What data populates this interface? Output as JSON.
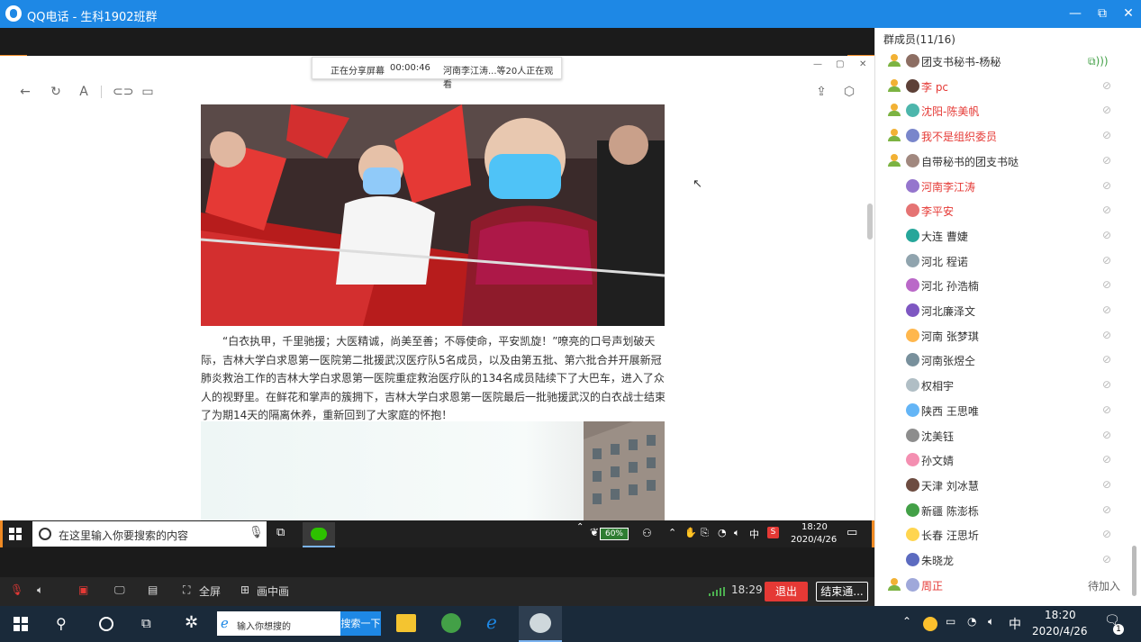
{
  "window": {
    "title": "QQ电话 - 生科1902班群",
    "min": "—",
    "max": "⧉",
    "close": "✕"
  },
  "share_bar": {
    "status": "正在分享屏幕",
    "time": "00:00:46",
    "viewers": "河南李江涛...等20人正在观看"
  },
  "article": {
    "paragraph": "“白衣执甲，千里驰援；大医精诚，尚美至善；不辱使命，平安凯旋！”嘹亮的口号声划破天际，吉林大学白求恩第一医院第二批援武汉医疗队5名成员，以及由第五批、第六批合并开展新冠肺炎救治工作的吉林大学白求恩第一医院重症救治医疗队的134名成员陆续下了大巴车，进入了众人的视野里。在鲜花和掌声的簇拥下，吉林大学白求恩第一医院最后一批驰援武汉的白衣战士结束了为期14天的隔离休养，重新回到了大家庭的怀抱！"
  },
  "inner_taskbar": {
    "search_placeholder": "在这里输入你要搜索的内容",
    "battery": "60%",
    "ime": "中",
    "time": "18:20",
    "date": "2020/4/26"
  },
  "controls": {
    "fullscreen": "全屏",
    "pip": "画中画",
    "signal_time": "18:29",
    "exit": "退出",
    "end": "结束通..."
  },
  "members_panel": {
    "title": "群成员(11/16)",
    "members": [
      {
        "name": "团支书秘书-杨秘",
        "red": false,
        "host": true
      },
      {
        "name": "李 pc",
        "red": true,
        "host": true
      },
      {
        "name": "沈阳-陈美帆",
        "red": true,
        "host": true
      },
      {
        "name": "我不是组织委员",
        "red": true,
        "host": true
      },
      {
        "name": "自带秘书的团支书哒",
        "red": false,
        "host": true
      },
      {
        "name": "河南李江涛",
        "red": true,
        "host": false
      },
      {
        "name": "李平安",
        "red": true,
        "host": false
      },
      {
        "name": "大连 曹婕",
        "red": false,
        "host": false
      },
      {
        "name": "河北  程诺",
        "red": false,
        "host": false
      },
      {
        "name": "河北  孙浩楠",
        "red": false,
        "host": false
      },
      {
        "name": "河北廉泽文",
        "red": false,
        "host": false
      },
      {
        "name": "河南 张梦琪",
        "red": false,
        "host": false
      },
      {
        "name": "河南张煜仝",
        "red": false,
        "host": false
      },
      {
        "name": "权相宇",
        "red": false,
        "host": false
      },
      {
        "name": "陕西 王思唯",
        "red": false,
        "host": false
      },
      {
        "name": "沈美钰",
        "red": false,
        "host": false
      },
      {
        "name": "孙文婧",
        "red": false,
        "host": false
      },
      {
        "name": "天津 刘冰慧",
        "red": false,
        "host": false
      },
      {
        "name": "新疆 陈澎栎",
        "red": false,
        "host": false
      },
      {
        "name": "长春 汪思圻",
        "red": false,
        "host": false
      },
      {
        "name": "朱晓龙",
        "red": false,
        "host": false
      },
      {
        "name": "周正",
        "red": true,
        "host": true,
        "status": "待加入"
      }
    ]
  },
  "taskbar": {
    "search_placeholder": "输入你想搜的",
    "search_button": "搜索一下",
    "ime": "中",
    "time": "18:20",
    "date": "2020/4/26",
    "notify_count": "1"
  }
}
